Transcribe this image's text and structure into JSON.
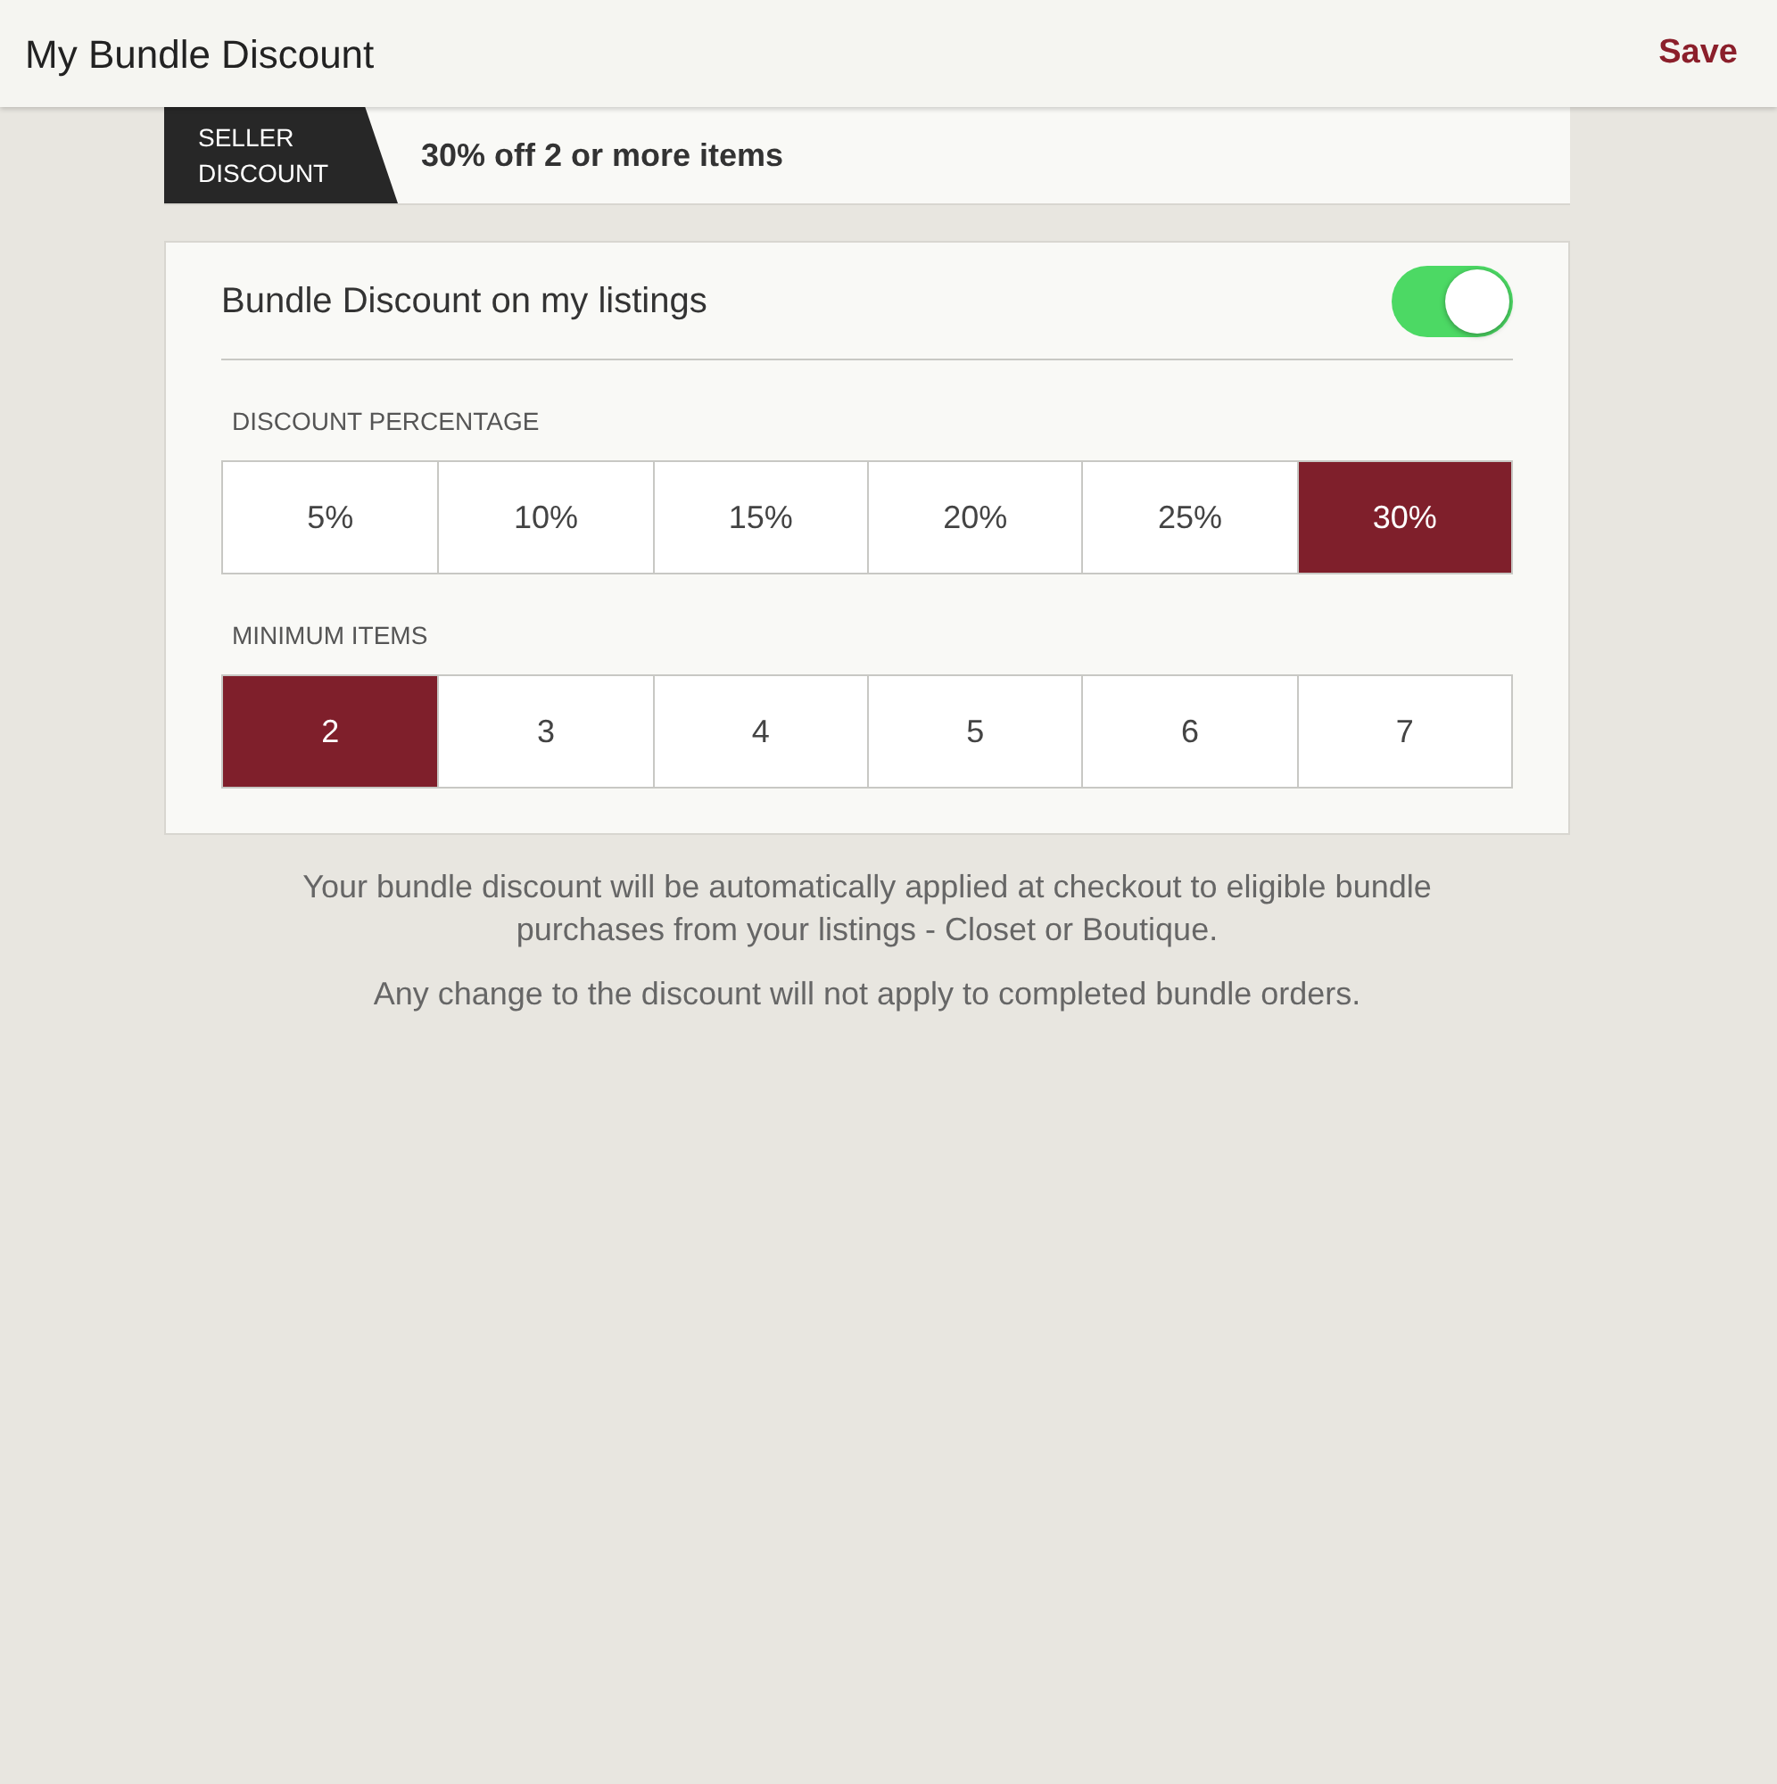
{
  "header": {
    "title": "My Bundle Discount",
    "action": "Save"
  },
  "banner": {
    "badge": "SELLER DISCOUNT",
    "text": "30% off 2 or more items"
  },
  "toggle": {
    "label": "Bundle Discount on my listings",
    "on": true
  },
  "discount_percentage": {
    "label": "DISCOUNT PERCENTAGE",
    "options": [
      {
        "label": "5%",
        "selected": false
      },
      {
        "label": "10%",
        "selected": false
      },
      {
        "label": "15%",
        "selected": false
      },
      {
        "label": "20%",
        "selected": false
      },
      {
        "label": "25%",
        "selected": false
      },
      {
        "label": "30%",
        "selected": true
      }
    ]
  },
  "minimum_items": {
    "label": "MINIMUM ITEMS",
    "options": [
      {
        "label": "2",
        "selected": true
      },
      {
        "label": "3",
        "selected": false
      },
      {
        "label": "4",
        "selected": false
      },
      {
        "label": "5",
        "selected": false
      },
      {
        "label": "6",
        "selected": false
      },
      {
        "label": "7",
        "selected": false
      }
    ]
  },
  "notes": [
    "Your bundle discount will be automatically applied at checkout to eligible bundle purchases from your listings - Closet or Boutique.",
    "Any change to the discount will not apply to completed bundle orders."
  ]
}
